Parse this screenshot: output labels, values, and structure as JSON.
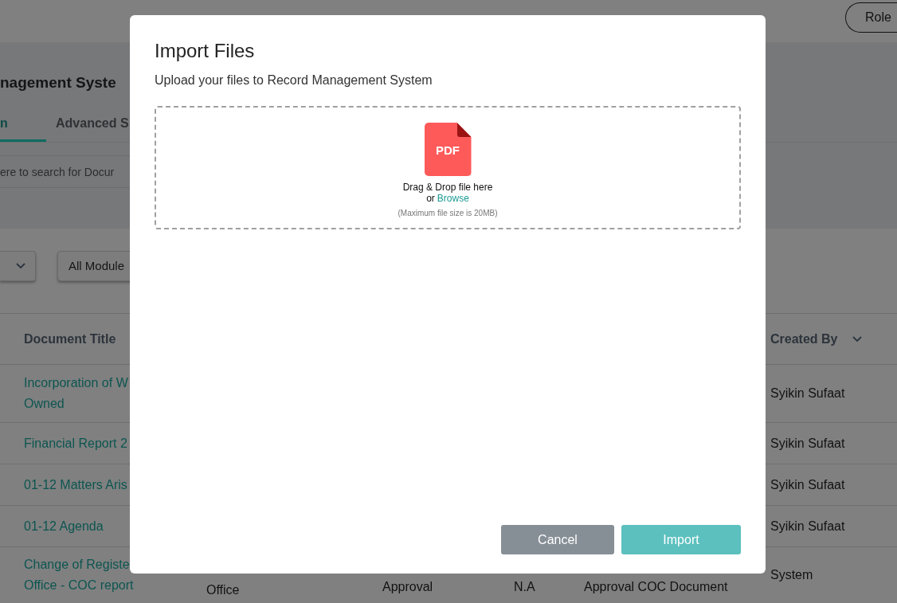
{
  "header": {
    "role_button": "Role"
  },
  "page": {
    "title": "nagement Syste",
    "tabs": [
      {
        "label": "n",
        "selected": true
      },
      {
        "label": "Advanced S",
        "selected": false
      }
    ],
    "search": {
      "placeholder": "ere to search for Docur"
    },
    "filters": [
      {
        "kind": "select"
      },
      {
        "kind": "select",
        "label": "All Module"
      }
    ]
  },
  "table": {
    "columns": [
      {
        "label": "Document Title",
        "sortable": false
      },
      {
        "label": "Created By",
        "sortable": true
      }
    ],
    "rows": [
      {
        "title": [
          "Incorporation of W",
          "Owned"
        ],
        "created_by": "Syikin Sufaat"
      },
      {
        "title": [
          "Financial Report 2"
        ],
        "created_by": "Syikin Sufaat"
      },
      {
        "title": [
          "01-12 Matters Aris"
        ],
        "created_by": "Syikin Sufaat"
      },
      {
        "title": [
          "01-12 Agenda"
        ],
        "created_by": "Syikin Sufaat"
      },
      {
        "title": [
          "Change of Registe",
          "Office - COC report"
        ],
        "column_2": "Office",
        "column_3": "Approval",
        "column_4": "N.A",
        "column_5": "Approval COC Document",
        "created_by": "System"
      }
    ]
  },
  "dialog": {
    "title": "Import Files",
    "subtitle": "Upload your files to Record Management System",
    "dropzone": {
      "file_icon_label": "PDF",
      "instruction": "Drag & Drop file here",
      "browse_prefix": "or",
      "browse_link": "Browse",
      "note": "(Maximum file size is 20MB)"
    },
    "buttons": [
      {
        "kind": "secondary",
        "label": "Cancel"
      },
      {
        "kind": "primary",
        "label": "Import"
      }
    ]
  }
}
